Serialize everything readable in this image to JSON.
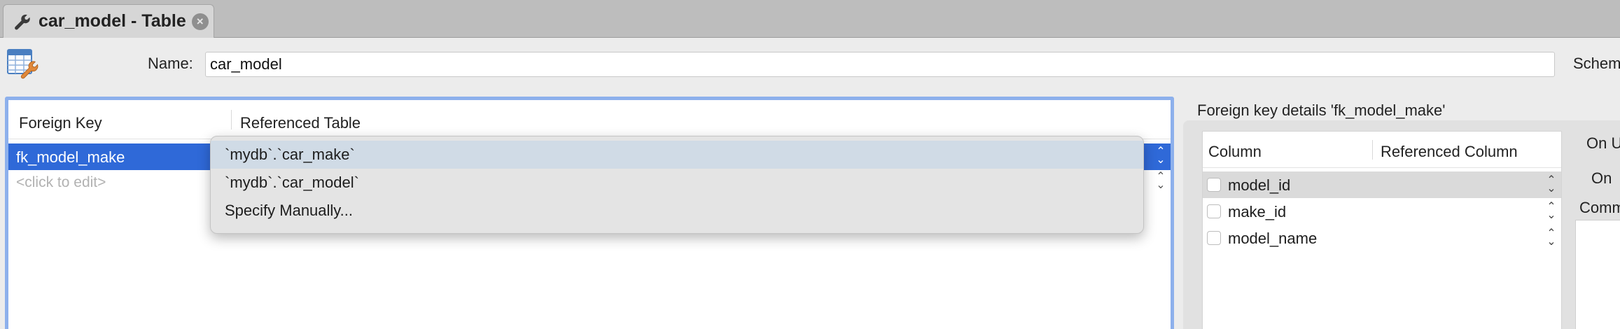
{
  "tab": {
    "title": "car_model - Table",
    "close_glyph": "×",
    "icon": "wrench-icon"
  },
  "name_row": {
    "label": "Name:",
    "value": "car_model",
    "schema_label": "Schem"
  },
  "fk_table": {
    "headers": {
      "foreign_key": "Foreign Key",
      "referenced_table": "Referenced Table"
    },
    "rows": [
      {
        "name": "fk_model_make"
      },
      {
        "placeholder": "<click to edit>"
      }
    ]
  },
  "popup": {
    "items": [
      {
        "label": "`mydb`.`car_make`"
      },
      {
        "label": "`mydb`.`car_model`"
      },
      {
        "label": "Specify Manually..."
      }
    ]
  },
  "details": {
    "title": "Foreign key details 'fk_model_make'",
    "headers": {
      "column": "Column",
      "referenced_column": "Referenced Column"
    },
    "columns": [
      {
        "name": "model_id"
      },
      {
        "name": "make_id"
      },
      {
        "name": "model_name"
      }
    ],
    "on_update_label": "On U",
    "on_delete_label": "On",
    "comment_label": "Comm"
  },
  "colors": {
    "selection": "#2f69d8",
    "focus_ring": "#8db0ec",
    "tab_strip": "#bdbdbd"
  }
}
